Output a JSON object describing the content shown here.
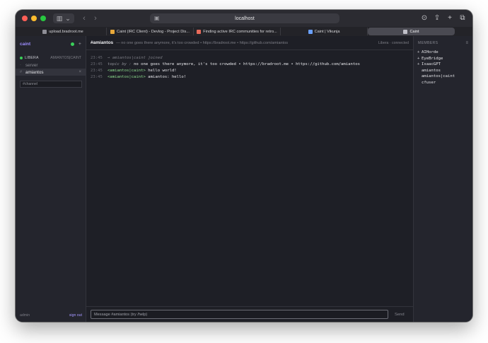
{
  "browser": {
    "url": "localhost",
    "tabs": [
      {
        "label": "upload.bradroot.me",
        "favicon_color": "#8e8e96",
        "active": false
      },
      {
        "label": "Caint (IRC Client) - Devlog - Project Dis...",
        "favicon_color": "#e8a83a",
        "active": false
      },
      {
        "label": "Finding active IRC communities for retro...",
        "favicon_color": "#e86a5a",
        "active": false
      },
      {
        "label": "Caint | Vikunja",
        "favicon_color": "#6aa0ff",
        "active": false
      },
      {
        "label": "Caint",
        "favicon_color": "#c0c0c8",
        "active": true
      }
    ]
  },
  "sidebar": {
    "brand": "caint",
    "status_color": "#3ad05a",
    "add_label": "+",
    "network": {
      "name": "LIBERA",
      "nick": "AMIANTOS|CAINT",
      "status_color": "#3ad05a"
    },
    "channels": [
      {
        "prefix": "·",
        "name": "server",
        "active": false
      },
      {
        "prefix": "#",
        "name": "amiantos",
        "active": true,
        "close": "×"
      }
    ],
    "join_placeholder": "#channel",
    "footer": {
      "user": "admin",
      "signout": "sign out"
    }
  },
  "main": {
    "channel": "#amiantos",
    "topic": "— no one goes there anymore, it's too crowded • https://bradroot.me • https://github.com/amiantos",
    "network_status": "Libera · connected",
    "messages": [
      {
        "time": "23:45",
        "kind": "join",
        "text": "→ amiantos|caint joined"
      },
      {
        "time": "23:45",
        "kind": "topic",
        "by": "topic by :",
        "text": "no one goes there anymore, it's too crowded • https://bradroot.me • https://github.com/amiantos"
      },
      {
        "time": "23:45",
        "kind": "message",
        "nick": "<amiantos|caint>",
        "text": "hello world!"
      },
      {
        "time": "23:45",
        "kind": "message",
        "nick": "<amiantos|caint>",
        "text": "amiantos: hello!"
      }
    ],
    "composer": {
      "placeholder": "Message #amiantos (try /help)",
      "send_label": "Send"
    }
  },
  "members": {
    "title": "MEMBERS",
    "list": [
      {
        "mode": "+",
        "nick": "AIHorde"
      },
      {
        "mode": "+",
        "nick": "EyeBridge"
      },
      {
        "mode": "+",
        "nick": "IsaacGPT"
      },
      {
        "mode": "",
        "nick": "amiantos"
      },
      {
        "mode": "",
        "nick": "amiantos|caint"
      },
      {
        "mode": "",
        "nick": "cfuser"
      }
    ]
  }
}
